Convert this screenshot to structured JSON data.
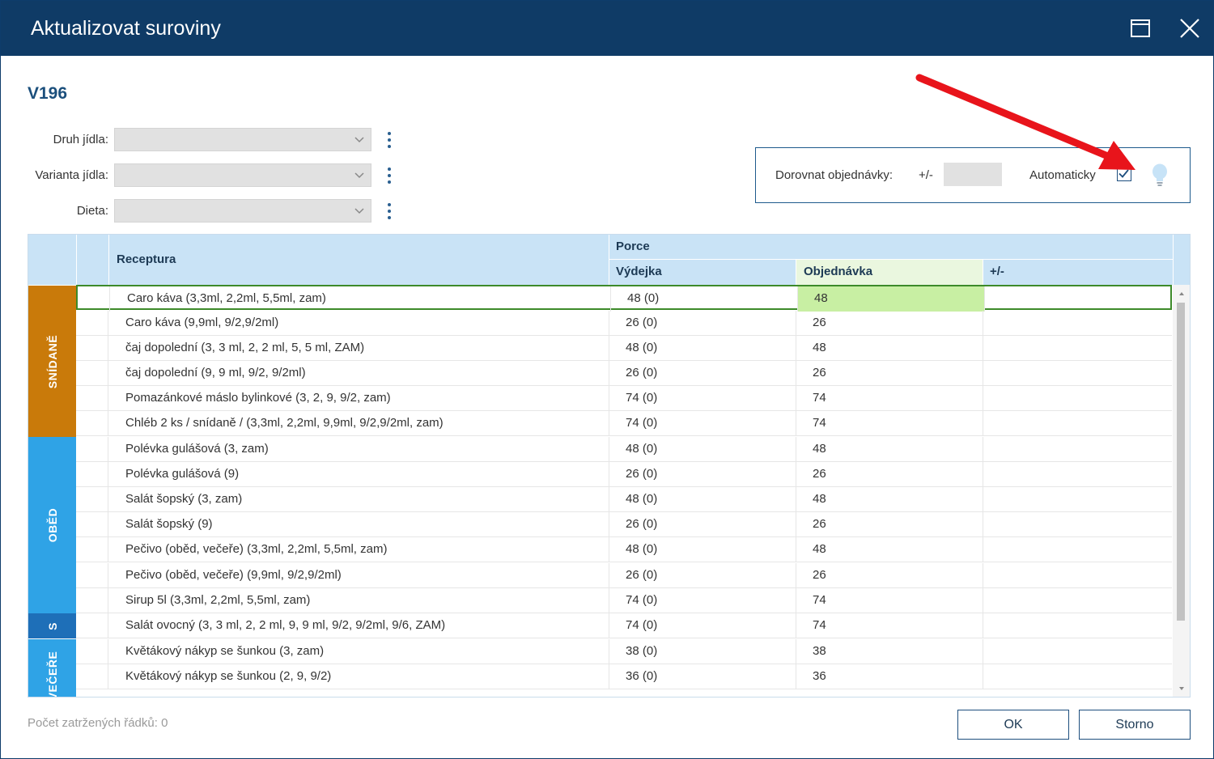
{
  "window": {
    "title": "Aktualizovat suroviny"
  },
  "doc_code": "V196",
  "filters": [
    {
      "label": "Druh jídla:",
      "value": ""
    },
    {
      "label": "Varianta jídla:",
      "value": ""
    },
    {
      "label": "Dieta:",
      "value": ""
    }
  ],
  "adjust": {
    "label": "Dorovnat objednávky:",
    "sign": "+/-",
    "value": "",
    "auto_label": "Automaticky",
    "auto_checked": true
  },
  "grid": {
    "headers": {
      "receptura": "Receptura",
      "porce": "Porce",
      "vydejka": "Výdejka",
      "objednavka": "Objednávka",
      "plusminus": "+/-"
    },
    "sections": [
      {
        "label": "SNÍDANĚ",
        "color": "#c97a0a"
      },
      {
        "label": "OBĚD",
        "color": "#2fa3e6"
      },
      {
        "label": "S",
        "color": "#1e6fb8"
      },
      {
        "label": "VEČEŘE",
        "color": "#2fa3e6"
      }
    ],
    "rows": [
      {
        "receptura": "Caro káva (3,3ml,  2,2ml, 5,5ml, zam)",
        "vydejka": "48 (0)",
        "objednavka": "48",
        "plusminus": ""
      },
      {
        "receptura": "Caro káva (9,9ml, 9/2,9/2ml)",
        "vydejka": "26 (0)",
        "objednavka": "26",
        "plusminus": ""
      },
      {
        "receptura": "čaj dopolední (3, 3 ml, 2, 2 ml, 5, 5 ml, ZAM)",
        "vydejka": "48 (0)",
        "objednavka": "48",
        "plusminus": ""
      },
      {
        "receptura": "čaj dopolední (9, 9 ml, 9/2, 9/2ml)",
        "vydejka": "26 (0)",
        "objednavka": "26",
        "plusminus": ""
      },
      {
        "receptura": "Pomazánkové máslo bylinkové (3, 2, 9, 9/2, zam)",
        "vydejka": "74 (0)",
        "objednavka": "74",
        "plusminus": ""
      },
      {
        "receptura": "Chléb 2 ks / snídaně / (3,3ml, 2,2ml, 9,9ml, 9/2,9/2ml, zam)",
        "vydejka": "74 (0)",
        "objednavka": "74",
        "plusminus": ""
      },
      {
        "receptura": "Polévka gulášová (3, zam)",
        "vydejka": "48 (0)",
        "objednavka": "48",
        "plusminus": ""
      },
      {
        "receptura": "Polévka gulášová (9)",
        "vydejka": "26 (0)",
        "objednavka": "26",
        "plusminus": ""
      },
      {
        "receptura": "Salát šopský (3, zam)",
        "vydejka": "48 (0)",
        "objednavka": "48",
        "plusminus": ""
      },
      {
        "receptura": "Salát šopský (9)",
        "vydejka": "26 (0)",
        "objednavka": "26",
        "plusminus": ""
      },
      {
        "receptura": "Pečivo (oběd, večeře) (3,3ml,  2,2ml, 5,5ml, zam)",
        "vydejka": "48 (0)",
        "objednavka": "48",
        "plusminus": ""
      },
      {
        "receptura": "Pečivo (oběd, večeře) (9,9ml,  9/2,9/2ml)",
        "vydejka": "26 (0)",
        "objednavka": "26",
        "plusminus": ""
      },
      {
        "receptura": "Sirup 5l (3,3ml,  2,2ml, 5,5ml, zam)",
        "vydejka": "74 (0)",
        "objednavka": "74",
        "plusminus": ""
      },
      {
        "receptura": "Salát ovocný (3, 3 ml, 2, 2 ml, 9, 9 ml, 9/2, 9/2ml, 9/6, ZAM)",
        "vydejka": "74 (0)",
        "objednavka": "74",
        "plusminus": ""
      },
      {
        "receptura": "Květákový nákyp se šunkou (3, zam)",
        "vydejka": "38 (0)",
        "objednavka": "38",
        "plusminus": ""
      },
      {
        "receptura": "Květákový nákyp se šunkou (2, 9, 9/2)",
        "vydejka": "36 (0)",
        "objednavka": "36",
        "plusminus": ""
      }
    ]
  },
  "footer": {
    "count_label": "Počet zatržených řádků: 0",
    "ok_label": "OK",
    "storno_label": "Storno"
  }
}
